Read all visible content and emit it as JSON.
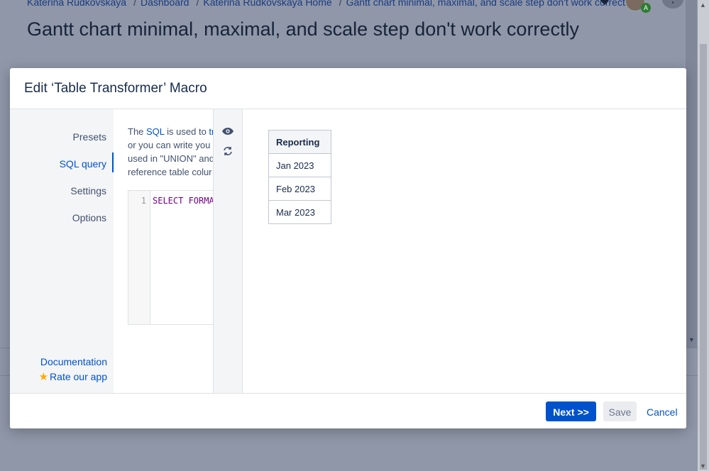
{
  "breadcrumbs": [
    "Katerina Rudkovskaya",
    "Dashboard",
    "Katerina Rudkovskaya Home",
    "Gantt chart minimal, maximal, and scale step don't work correctly"
  ],
  "page": {
    "title": "Gantt chart minimal, maximal, and scale step don't work correctly",
    "avatar_badge": "A",
    "more_label": "⋮"
  },
  "modal": {
    "title": "Edit ‘Table Transformer’ Macro",
    "nav": [
      "Presets",
      "SQL query",
      "Settings",
      "Options"
    ],
    "active_nav": "SQL query",
    "links": {
      "documentation": "Documentation",
      "rate": "Rate our app"
    },
    "sql": {
      "desc_lines": [
        {
          "pre": "The ",
          "link": "SQL",
          "mid": " is used to ",
          "link2": "tr"
        },
        {
          "text": "or you can write you"
        },
        {
          "text": "used in \"UNION\" and"
        },
        {
          "text": "reference table colur"
        }
      ],
      "line_number": "1",
      "code": "SELECT FORMA"
    },
    "tools": {
      "preview_icon": "eye-icon",
      "refresh_icon": "refresh-icon"
    },
    "preview_table": {
      "header": "Reporting",
      "rows": [
        "Jan 2023",
        "Feb 2023",
        "Mar 2023"
      ]
    },
    "footer": {
      "next": "Next >>",
      "save": "Save",
      "cancel": "Cancel"
    }
  },
  "colors": {
    "primary": "#0052cc",
    "overlay": "#8f97a8",
    "star": "#ffab00"
  }
}
